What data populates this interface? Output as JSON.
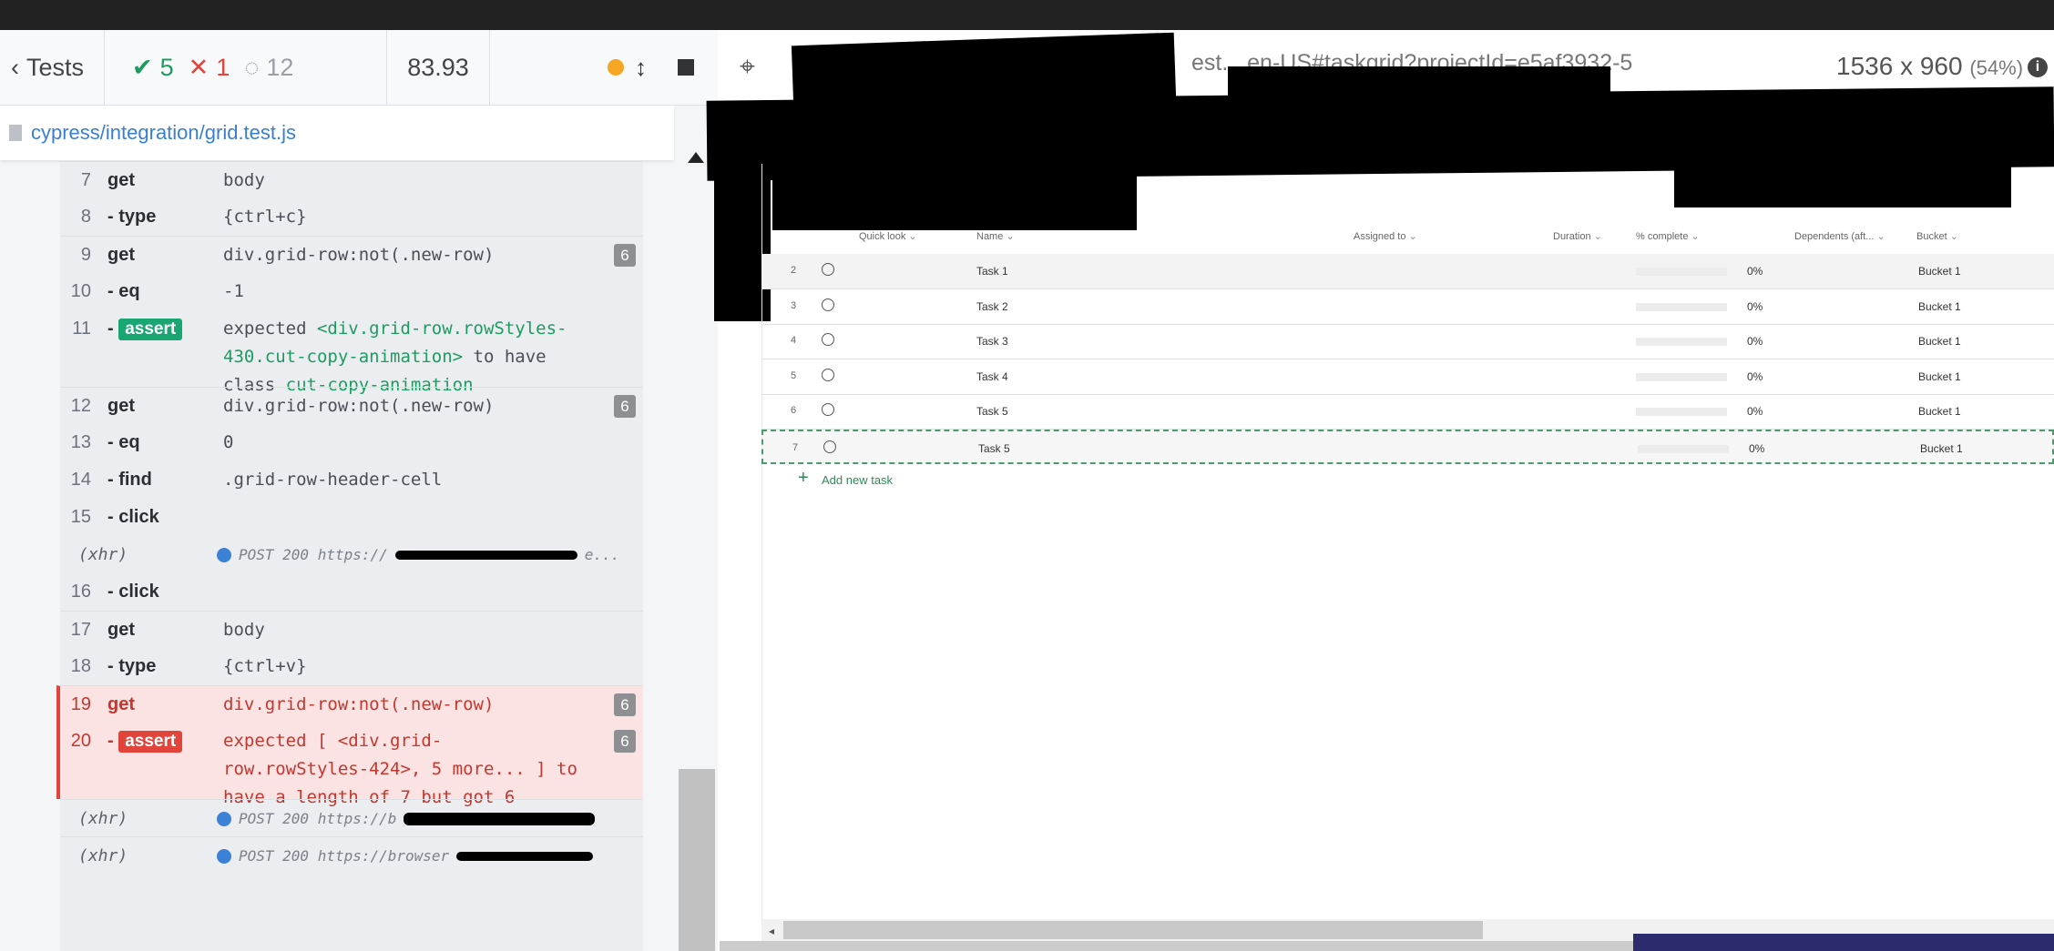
{
  "reporter": {
    "tests_label": "Tests",
    "passed": "5",
    "failed": "1",
    "pending": "12",
    "duration": "83.93",
    "file": "cypress/integration/grid.test.js",
    "commands": [
      {
        "num": "7",
        "cmd": "get",
        "msg": "body",
        "child": false,
        "badge": ""
      },
      {
        "num": "8",
        "cmd": "type",
        "msg": "{ctrl+c}",
        "child": true,
        "badge": ""
      },
      {
        "num": "9",
        "cmd": "get",
        "msg": "div.grid-row:not(.new-row)",
        "child": false,
        "badge": "6"
      },
      {
        "num": "10",
        "cmd": "eq",
        "msg": "-1",
        "child": true,
        "badge": ""
      },
      {
        "num": "12",
        "cmd": "get",
        "msg": "div.grid-row:not(.new-row)",
        "child": false,
        "badge": "6"
      },
      {
        "num": "13",
        "cmd": "eq",
        "msg": "0",
        "child": true,
        "badge": ""
      },
      {
        "num": "14",
        "cmd": "find",
        "msg": ".grid-row-header-cell",
        "child": true,
        "badge": ""
      },
      {
        "num": "15",
        "cmd": "click",
        "msg": "",
        "child": true,
        "badge": ""
      },
      {
        "num": "16",
        "cmd": "click",
        "msg": "",
        "child": true,
        "badge": ""
      },
      {
        "num": "17",
        "cmd": "get",
        "msg": "body",
        "child": false,
        "badge": ""
      },
      {
        "num": "18",
        "cmd": "type",
        "msg": "{ctrl+v}",
        "child": true,
        "badge": ""
      },
      {
        "num": "19",
        "cmd": "get",
        "msg": "div.grid-row:not(.new-row)",
        "child": false,
        "badge": "6"
      }
    ],
    "assert11": {
      "num": "11",
      "pill": "assert",
      "line1_a": "expected ",
      "line1_b": "<div.grid-row.rowStyles-",
      "line2_b": "430.cut-copy-animation>",
      "line2_c": " to have",
      "line3_a": "class ",
      "line3_b": "cut-copy-animation"
    },
    "assert20": {
      "num": "20",
      "pill": "assert",
      "badge": "6",
      "line1_a": "expected ",
      "line1_b": "[ <div.grid-",
      "line2_b": "row.rowStyles-424>, 5 more... ]",
      "line2_c": " to",
      "line3_a": "have a length of ",
      "line3_b": "7",
      "line3_c": " but got ",
      "line3_d": "6"
    },
    "xhr_label": "(xhr)",
    "xhr1": "POST 200 https://",
    "xhr1_tail": "e...",
    "xhr2": "POST 200 https://b",
    "xhr3": "POST 200 https://browser"
  },
  "preview": {
    "url_fragment": "est... en-US#taskgrid?projectId=e5af3932-5",
    "viewport": "1536 x 960",
    "scale": "(54%)",
    "columns": {
      "quick": "Quick look",
      "name": "Name",
      "assigned": "Assigned to",
      "duration": "Duration",
      "complete": "% complete",
      "dependents": "Dependents (aft...",
      "bucket": "Bucket"
    },
    "rows": [
      {
        "n": "2",
        "name": "Task 1",
        "pct": "0%",
        "bucket": "Bucket 1"
      },
      {
        "n": "3",
        "name": "Task 2",
        "pct": "0%",
        "bucket": "Bucket 1"
      },
      {
        "n": "4",
        "name": "Task 3",
        "pct": "0%",
        "bucket": "Bucket 1"
      },
      {
        "n": "5",
        "name": "Task 4",
        "pct": "0%",
        "bucket": "Bucket 1"
      },
      {
        "n": "6",
        "name": "Task 5",
        "pct": "0%",
        "bucket": "Bucket 1"
      },
      {
        "n": "7",
        "name": "Task 5",
        "pct": "0%",
        "bucket": "Bucket 1"
      }
    ],
    "add_task": "Add new task"
  }
}
